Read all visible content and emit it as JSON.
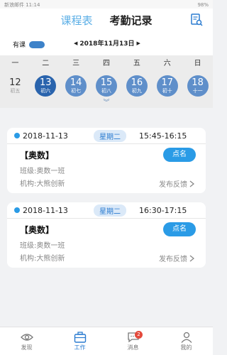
{
  "status_bar": {
    "left": "新浪邮件 11:14",
    "right": "98%"
  },
  "header": {
    "tabs": [
      {
        "label": "课程表",
        "active": false
      },
      {
        "label": "考勤记录",
        "active": true
      }
    ],
    "right_icon": "search-doc-icon"
  },
  "filter": {
    "has_class_label": "有课",
    "toggle_on": true,
    "current_date": "2018年11月13日"
  },
  "week_headers": [
    "一",
    "二",
    "三",
    "四",
    "五",
    "六",
    "日"
  ],
  "days": [
    {
      "num": "12",
      "lunar": "初五",
      "state": "past"
    },
    {
      "num": "13",
      "lunar": "初六",
      "state": "selected"
    },
    {
      "num": "14",
      "lunar": "初七",
      "state": "future"
    },
    {
      "num": "15",
      "lunar": "初八",
      "state": "future"
    },
    {
      "num": "16",
      "lunar": "初九",
      "state": "future"
    },
    {
      "num": "17",
      "lunar": "初十",
      "state": "future"
    },
    {
      "num": "18",
      "lunar": "十一",
      "state": "future"
    }
  ],
  "expand_glyph": "︾",
  "cards": [
    {
      "date": "2018-11-13",
      "weekday": "星期二",
      "time": "15:45-16:15",
      "title": "【奥数】",
      "button": "点名",
      "class_line": "班级:奥数一班",
      "org_line": "机构:大熊创新",
      "feedback": "发布反馈"
    },
    {
      "date": "2018-11-13",
      "weekday": "星期二",
      "time": "16:30-17:15",
      "title": "【奥数】",
      "button": "点名",
      "class_line": "班级:奥数一班",
      "org_line": "机构:大熊创新",
      "feedback": "发布反馈"
    }
  ],
  "bottom_nav": [
    {
      "label": "发现",
      "icon": "eye-icon",
      "active": false
    },
    {
      "label": "工作",
      "icon": "briefcase-icon",
      "active": true
    },
    {
      "label": "消息",
      "icon": "chat-icon",
      "active": false,
      "badge": "2"
    },
    {
      "label": "我的",
      "icon": "person-icon",
      "active": false
    }
  ],
  "colors": {
    "accent": "#2a9be6",
    "selected_day": "#2a64ad",
    "future_day": "#5f8fca",
    "badge": "#e44a3c"
  }
}
